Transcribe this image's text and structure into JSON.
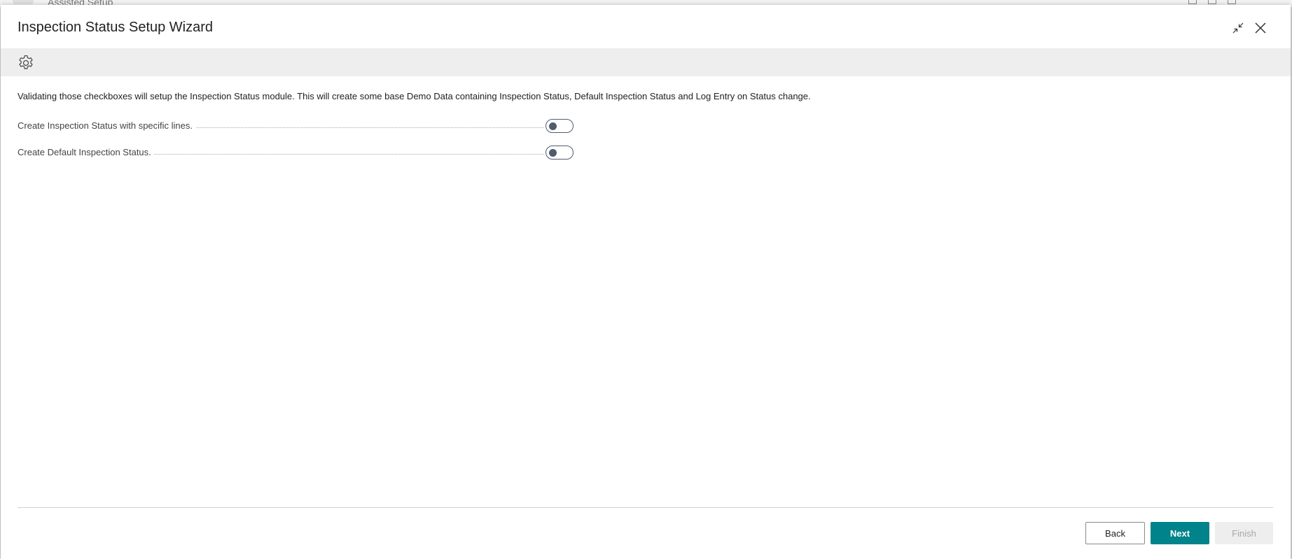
{
  "background_page": {
    "title": "Assisted Setup",
    "back_icon": "chevron-left-icon"
  },
  "dialog": {
    "title": "Inspection Status Setup Wizard",
    "icons": {
      "collapse": "collapse-icon",
      "close": "close-icon",
      "settings": "gear-icon"
    }
  },
  "content": {
    "instruction": "Validating those checkboxes will setup the Inspection Status module. This will create some base Demo Data containing Inspection Status, Default Inspection Status and Log Entry on Status change.",
    "fields": [
      {
        "label": "Create Inspection Status with specific lines.",
        "value": false
      },
      {
        "label": "Create Default Inspection Status.",
        "value": false
      }
    ]
  },
  "footer": {
    "back_label": "Back",
    "next_label": "Next",
    "finish_label": "Finish"
  },
  "colors": {
    "accent": "#00838a",
    "toggle": "#505c6d",
    "disabled_bg": "#eeeeee",
    "disabled_text": "#a8a8a8"
  }
}
